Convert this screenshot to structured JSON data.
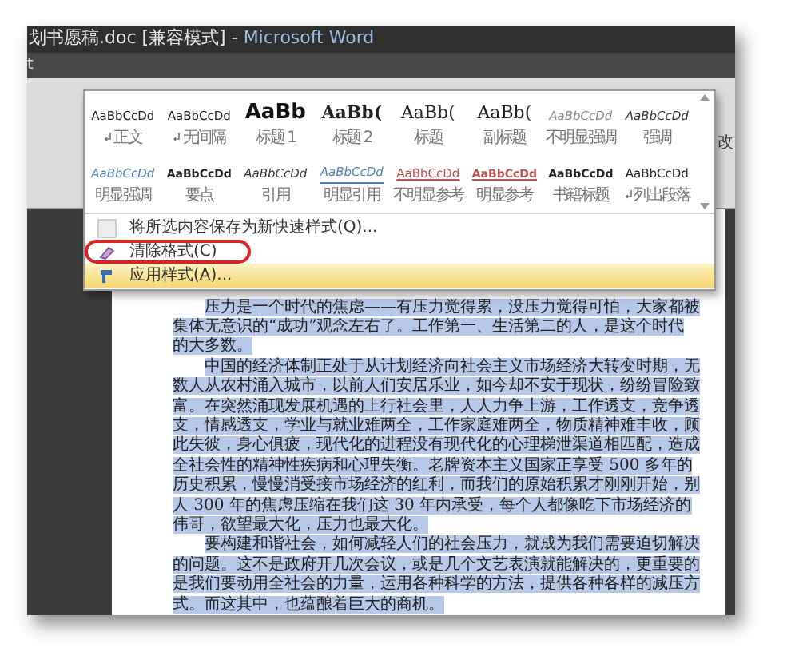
{
  "window": {
    "title_document": "划书愿稿.doc [兼容模式]",
    "title_separator": " - ",
    "title_app": "Microsoft Word"
  },
  "ribbon": {
    "tab_fragment": "t",
    "side_label": "改"
  },
  "styles_gallery": {
    "items": [
      {
        "sample": "AaBbCcDd",
        "label": "正文",
        "kind": "plain",
        "para_mark": true,
        "selected": false
      },
      {
        "sample": "AaBbCcDd",
        "label": "无间隔",
        "kind": "plain",
        "para_mark": true,
        "selected": false
      },
      {
        "sample": "AaBb",
        "label": "标题 1",
        "kind": "heading1",
        "para_mark": false,
        "selected": false
      },
      {
        "sample": "AaBb(",
        "label": "标题 2",
        "kind": "heading2",
        "para_mark": false,
        "selected": false
      },
      {
        "sample": "AaBb(",
        "label": "标题",
        "kind": "title",
        "para_mark": false,
        "selected": false
      },
      {
        "sample": "AaBb(",
        "label": "副标题",
        "kind": "title",
        "para_mark": false,
        "selected": false
      },
      {
        "sample": "AaBbCcDd",
        "label": "不明显强调",
        "kind": "subtle",
        "para_mark": false,
        "selected": false
      },
      {
        "sample": "AaBbCcDd",
        "label": "强调",
        "kind": "emphasis",
        "para_mark": false,
        "selected": false
      },
      {
        "sample": "AaBbCcDd",
        "label": "明显强调",
        "kind": "intense",
        "para_mark": false,
        "selected": false
      },
      {
        "sample": "AaBbCcDd",
        "label": "要点",
        "kind": "strong",
        "para_mark": false,
        "selected": false
      },
      {
        "sample": "AaBbCcDd",
        "label": "引用",
        "kind": "emphasis",
        "para_mark": false,
        "selected": false
      },
      {
        "sample": "AaBbCcDd",
        "label": "明显引用",
        "kind": "quote",
        "para_mark": false,
        "selected": false
      },
      {
        "sample": "AaBbCcDd",
        "label": "不明显参考",
        "kind": "subtleref",
        "para_mark": false,
        "selected": false
      },
      {
        "sample": "AaBbCcDd",
        "label": "明显参考",
        "kind": "intenseref",
        "para_mark": false,
        "selected": false
      },
      {
        "sample": "AaBbCcDd",
        "label": "书籍标题",
        "kind": "book",
        "para_mark": false,
        "selected": false
      },
      {
        "sample": "AaBbCcDd",
        "label": "列出段落",
        "kind": "plain",
        "para_mark": true,
        "selected": false
      }
    ]
  },
  "menu": {
    "items": [
      {
        "label": "将所选内容保存为新快速样式(Q)...",
        "kind": "save",
        "selected": false,
        "circled": false
      },
      {
        "label": "清除格式(C)",
        "kind": "clear",
        "selected": false,
        "circled": true
      },
      {
        "label": "应用样式(A)...",
        "kind": "apply",
        "selected": true,
        "circled": false
      }
    ]
  },
  "document": {
    "paragraphs": [
      {
        "text": "压力是一个时代的焦虑——有压力觉得累，没压力觉得可怕，大家都被集体无意识的“成功”观念左右了。工作第一、生活第二的人，是这个时代的大多数。",
        "selected": true
      },
      {
        "text": "中国的经济体制正处于从计划经济向社会主义市场经济大转变时期，无数人从农村涌入城市，以前人们安居乐业，如今却不安于现状，纷纷冒险致富。在突然涌现发展机遇的上行社会里，人人力争上游，工作透支，竞争透支，情感透支，学业与就业难两全，工作家庭难两全，物质精神难丰收，顾此失彼，身心俱疲，现代化的进程没有现代化的心理梯泄渠道相匹配，造成全社会性的精神性疾病和心理失衡。老牌资本主义国家正享受 500 多年的历史积累，慢慢消受接市场经济的红利，而我们的原始积累才刚刚开始，别人 300 年的焦虑压缩在我们这 30 年内承受，每个人都像吃下市场经济的伟哥，欲望最大化，压力也最大化。",
        "selected": true
      },
      {
        "text": "要构建和谐社会，如何减轻人们的社会压力，就成为我们需要迫切解决的问题。这不是政府开几次会议，或是几个文艺表演就能解决的，更重要的是我们要动用全社会的力量，运用各种科学的方法，提供各种各样的减压方式。而这其中，也蕴酿着巨大的商机。",
        "selected": true
      }
    ]
  }
}
